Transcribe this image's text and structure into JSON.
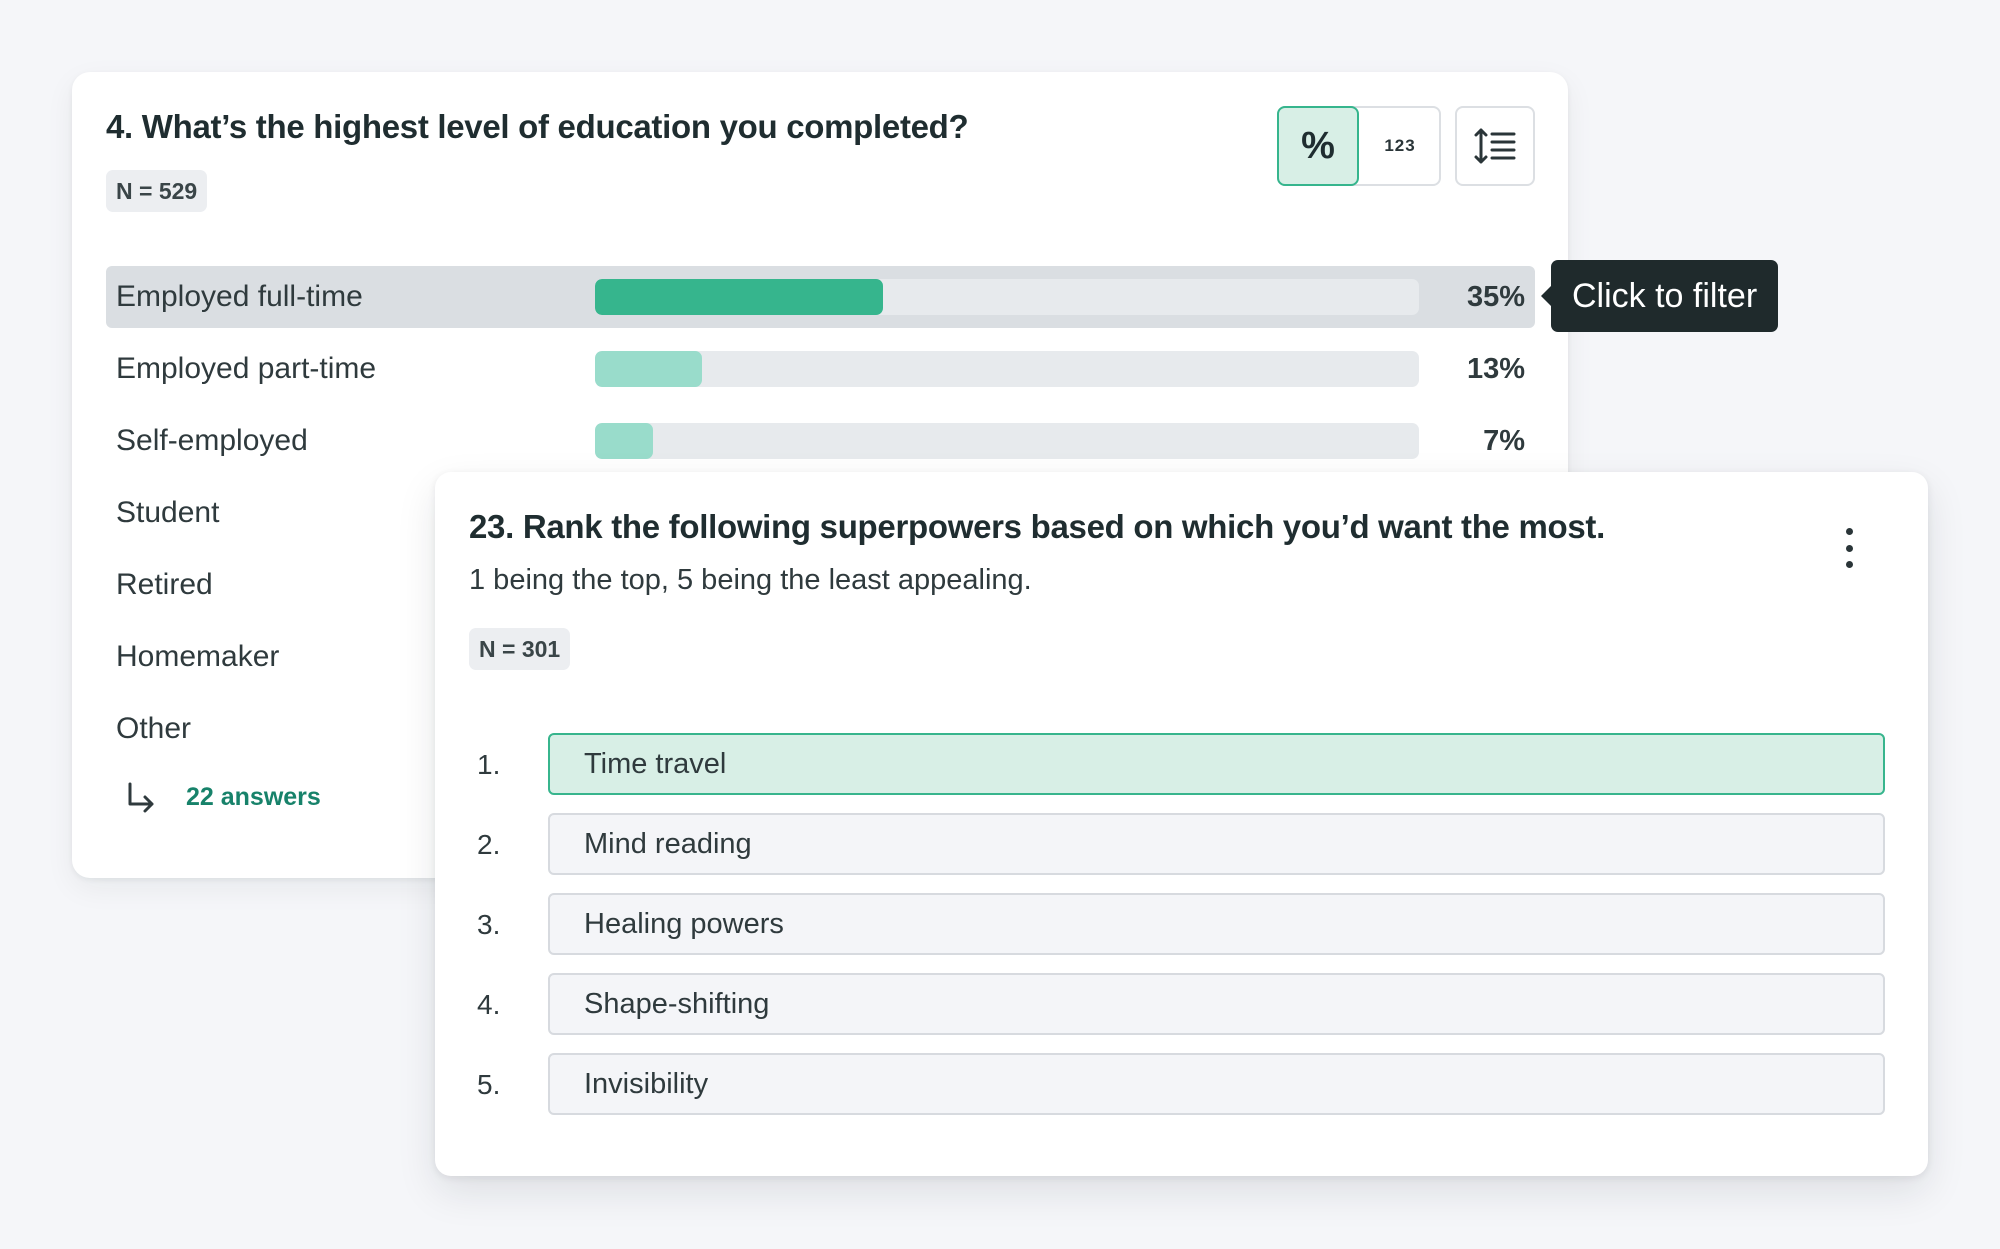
{
  "colors": {
    "accent": "#36b58d",
    "accent_light": "#99dccb",
    "accent_bg": "#d8efe6",
    "link": "#17826a",
    "tooltip_bg": "#1f2a2c"
  },
  "question4": {
    "title": "4. What’s the highest level of education you completed?",
    "n_label": "N = 529",
    "toggle": {
      "percent_label": "%",
      "number_label": "123",
      "selected": "percent"
    },
    "sort_icon": "sort-lines-icon",
    "rows": [
      {
        "label": "Employed full-time",
        "value": "35%",
        "fraction": 0.35,
        "highlight": true
      },
      {
        "label": "Employed part-time",
        "value": "13%",
        "fraction": 0.13
      },
      {
        "label": "Self-employed",
        "value": "7%",
        "fraction": 0.07
      },
      {
        "label": "Student"
      },
      {
        "label": "Retired"
      },
      {
        "label": "Homemaker"
      },
      {
        "label": "Other"
      }
    ],
    "answers_link": "22 answers"
  },
  "tooltip": {
    "text": "Click to filter"
  },
  "question23": {
    "title": "23. Rank the following superpowers based on which you’d want the most.",
    "subtitle": "1 being the top, 5 being the least appealing.",
    "n_label": "N = 301",
    "menu_icon": "kebab-menu-icon",
    "ranks": [
      {
        "num": "1.",
        "label": "Time travel",
        "active": true
      },
      {
        "num": "2.",
        "label": "Mind reading"
      },
      {
        "num": "3.",
        "label": "Healing powers"
      },
      {
        "num": "4.",
        "label": "Shape-shifting"
      },
      {
        "num": "5.",
        "label": "Invisibility"
      }
    ]
  }
}
